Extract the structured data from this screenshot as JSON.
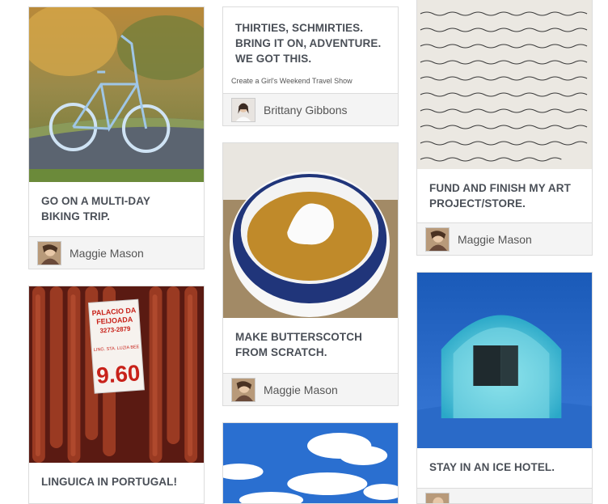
{
  "pins": [
    {
      "title": "GO ON A MULTI-DAY BIKING TRIP.",
      "user": "Maggie Mason"
    },
    {
      "title": "LINGUICA IN PORTUGAL!",
      "photo_sign": [
        "PALACIO DA",
        "FEIJOADA",
        "3273-2879",
        "LING. STA. LUZIA BEE",
        "9.60"
      ]
    },
    {
      "title": "THIRTIES, SCHMIRTIES. BRING IT ON, ADVENTURE. WE GOT THIS.",
      "subtitle": "Create a Girl's Weekend Travel Show",
      "user": "Brittany Gibbons"
    },
    {
      "title": "MAKE BUTTERSCOTCH FROM SCRATCH.",
      "user": "Maggie Mason"
    },
    {
      "title": "FUND AND FINISH MY ART PROJECT/STORE.",
      "user": "Maggie Mason"
    },
    {
      "title": "STAY IN AN ICE HOTEL."
    }
  ]
}
